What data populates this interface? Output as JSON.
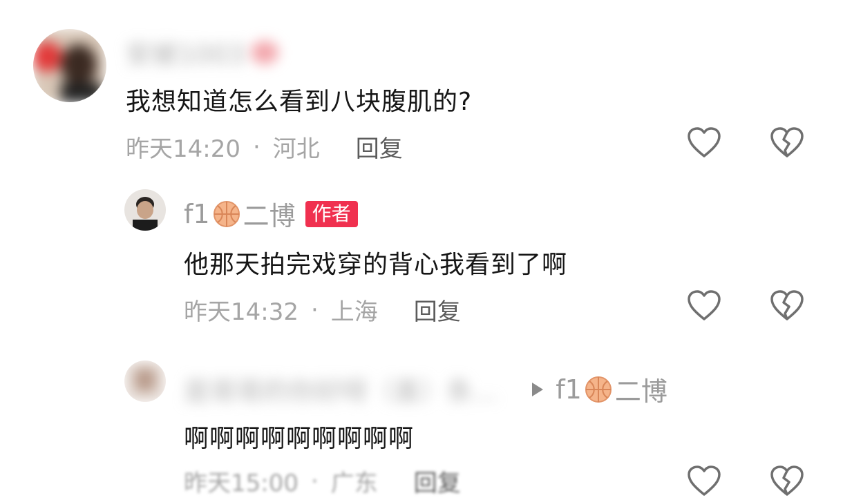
{
  "comments": [
    {
      "username": "安被1003",
      "text": "我想知道怎么看到八块腹肌的?",
      "time": "昨天14:20",
      "location": "河北",
      "reply_label": "回复",
      "like_icon": "heart-outline-icon",
      "dislike_icon": "broken-heart-icon"
    },
    {
      "username_prefix": "f1",
      "username_emoji": "basketball-icon",
      "username_suffix": "二博",
      "badge": "作者",
      "text": "他那天拍完戏穿的背心我看到了啊",
      "time": "昨天14:32",
      "location": "上海",
      "reply_label": "回复",
      "like_icon": "heart-outline-icon",
      "dislike_icon": "broken-heart-icon"
    },
    {
      "username": "是哥哥的你好呀（喜）条...",
      "reply_to_prefix": "f1",
      "reply_to_suffix": "二博",
      "text": "啊啊啊啊啊啊啊啊啊",
      "time": "昨天15:00",
      "location": "广东",
      "reply_label": "回复"
    }
  ],
  "colors": {
    "badge_bg": "#f0304f",
    "meta_text": "#a5a5a5",
    "reply_text": "#5c5c5c",
    "icon_stroke": "#6f6f6f"
  }
}
